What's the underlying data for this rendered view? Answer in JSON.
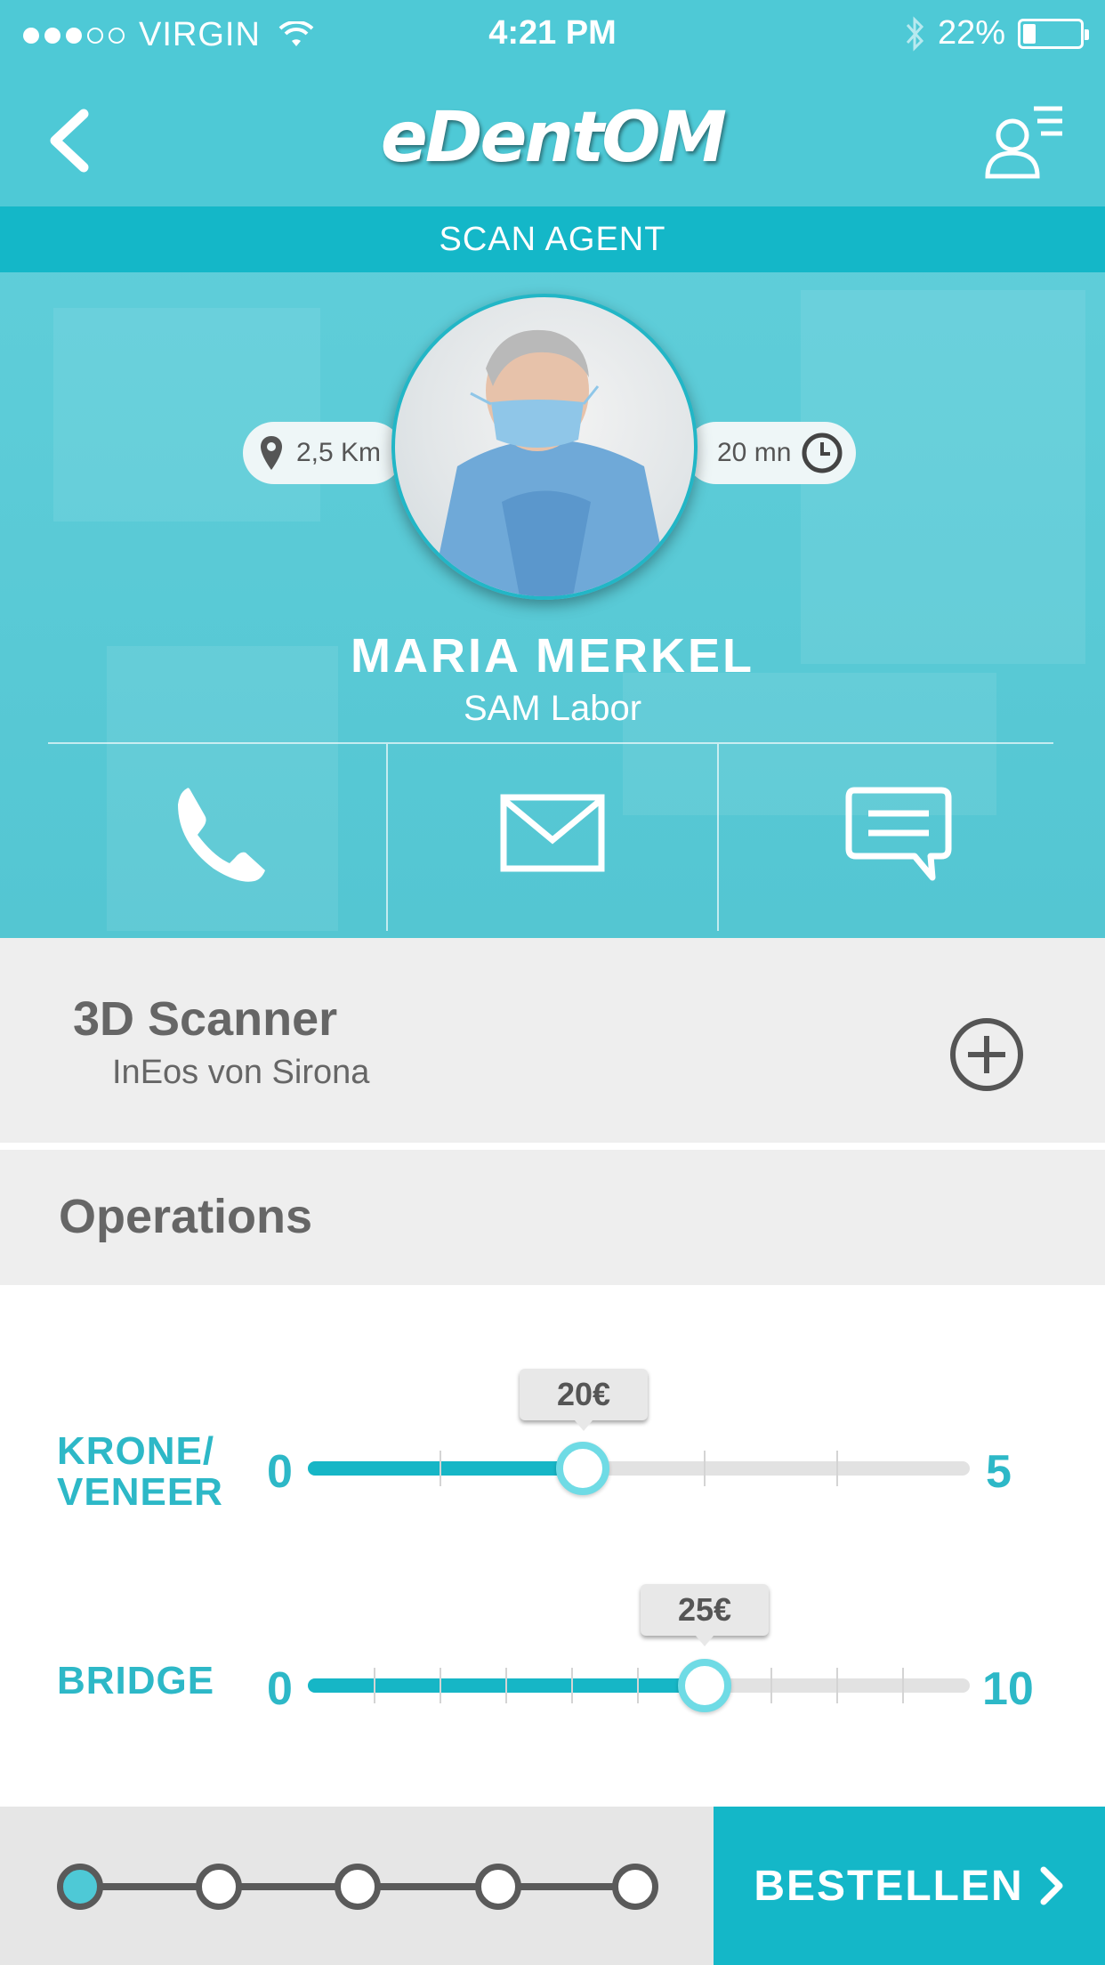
{
  "status_bar": {
    "carrier": "VIRGIN",
    "time": "4:21 PM",
    "battery": "22%",
    "signal_strength": "3 of 5"
  },
  "nav": {
    "logo": "eDentOM",
    "back_icon": "chevron-left-icon",
    "profile_icon": "user-menu-icon"
  },
  "section_title": "SCAN AGENT",
  "agent": {
    "distance": "2,5 Km",
    "duration": "20 mn",
    "name": "MARIA MERKEL",
    "company": "SAM Labor",
    "actions": [
      "phone-icon",
      "mail-icon",
      "chat-icon"
    ]
  },
  "device": {
    "title": "3D Scanner",
    "subtitle": "InEos von Sirona",
    "add_icon": "plus-circle-icon"
  },
  "operations": {
    "title": "Operations",
    "sliders": [
      {
        "label_line1": "KRONE/",
        "label_line2": "VENEER",
        "min": "0",
        "max": "5",
        "value_label": "20€",
        "position_fraction": 0.415
      },
      {
        "label_line1": "BRIDGE",
        "label_line2": "",
        "min": "0",
        "max": "10",
        "value_label": "25€",
        "position_fraction": 0.6
      }
    ]
  },
  "footer": {
    "steps_total": 5,
    "current_step": 1,
    "order_label": "BESTELLEN"
  },
  "colors": {
    "teal": "#4ec9d6",
    "teal_dark": "#14b7c8",
    "slider_text": "#2db8c7",
    "grey_text": "#666666"
  }
}
